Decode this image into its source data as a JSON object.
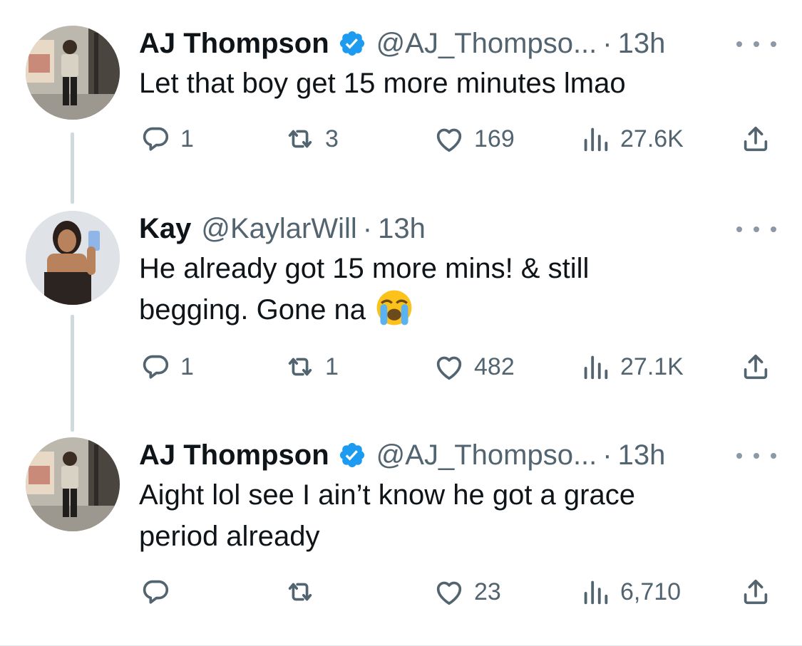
{
  "tweets": [
    {
      "name": "AJ Thompson",
      "verified": true,
      "handle": "@AJ_Thompso...",
      "separator": "·",
      "time": "13h",
      "text_lines": [
        "Let that boy get 15 more minutes lmao"
      ],
      "has_emoji": false,
      "replies": "1",
      "retweets": "3",
      "likes": "169",
      "views": "27.6K"
    },
    {
      "name": "Kay",
      "verified": false,
      "handle": "@KaylarWill",
      "separator": "·",
      "time": "13h",
      "text_lines": [
        "He already got 15 more mins! & still",
        "begging. Gone na"
      ],
      "has_emoji": true,
      "emoji": "loudly-crying-face",
      "replies": "1",
      "retweets": "1",
      "likes": "482",
      "views": "27.1K"
    },
    {
      "name": "AJ Thompson",
      "verified": true,
      "handle": "@AJ_Thompso...",
      "separator": "·",
      "time": "13h",
      "text_lines": [
        "Aight lol see I ain’t know he got a grace",
        "period already"
      ],
      "has_emoji": false,
      "replies": "",
      "retweets": "",
      "likes": "23",
      "views": "6,710"
    }
  ],
  "colors": {
    "text": "#0f1419",
    "secondary": "#536471",
    "verified_blue": "#1d9bf0",
    "thread_line": "#cfd9de"
  },
  "icons": [
    "reply-icon",
    "retweet-icon",
    "like-icon",
    "views-icon",
    "share-icon",
    "more-icon",
    "verified-badge-icon"
  ]
}
